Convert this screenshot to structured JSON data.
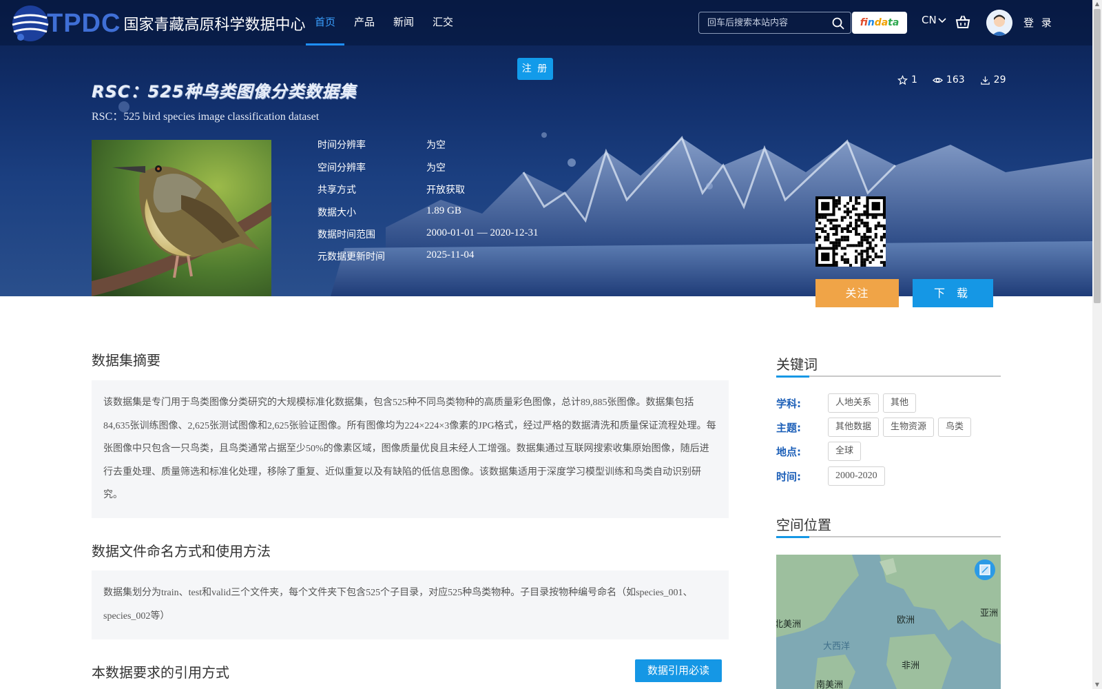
{
  "nav": {
    "logo_text": "TPDC",
    "logo_cn": "国家青藏高原科学数据中心",
    "items": [
      {
        "label": "首页",
        "active": true
      },
      {
        "label": "产品"
      },
      {
        "label": "新闻"
      },
      {
        "label": "汇交"
      }
    ],
    "search_placeholder": "回车后搜索本站内容",
    "findata": [
      "f",
      "in",
      "da",
      "ta"
    ],
    "lang": "CN",
    "login": "登 录"
  },
  "register_label": "注 册",
  "dataset": {
    "title": "RSC：525种鸟类图像分类数据集",
    "subtitle": "RSC：525 bird species image classification dataset",
    "stats": {
      "stars": "1",
      "views": "163",
      "downloads": "29"
    },
    "meta": [
      {
        "label": "时间分辨率",
        "value": "为空"
      },
      {
        "label": "空间分辨率",
        "value": "为空"
      },
      {
        "label": "共享方式",
        "value": "开放获取"
      },
      {
        "label": "数据大小",
        "value": "1.89 GB"
      },
      {
        "label": "数据时间范围",
        "value": "2000-01-01 — 2020-12-31"
      },
      {
        "label": "元数据更新时间",
        "value": "2025-11-04"
      }
    ],
    "follow_label": "关注",
    "download_label": "下 载"
  },
  "summary": {
    "title": "数据集摘要",
    "text": "该数据集是专门用于鸟类图像分类研究的大规模标准化数据集，包含525种不同鸟类物种的高质量彩色图像，总计89,885张图像。数据集包括84,635张训练图像、2,625张测试图像和2,625张验证图像。所有图像均为224×224×3像素的JPG格式，经过严格的数据清洗和质量保证流程处理。每张图像中只包含一只鸟类，且鸟类通常占据至少50%的像素区域，图像质量优良且未经人工增强。数据集通过互联网搜索收集原始图像，随后进行去重处理、质量筛选和标准化处理，移除了重复、近似重复以及有缺陷的低信息图像。该数据集适用于深度学习模型训练和鸟类自动识别研究。"
  },
  "naming": {
    "title": "数据文件命名方式和使用方法",
    "text": "数据集划分为train、test和valid三个文件夹，每个文件夹下包含525个子目录，对应525种鸟类物种。子目录按物种编号命名（如species_001、species_002等）"
  },
  "citation": {
    "title": "本数据要求的引用方式",
    "button": "数据引用必读"
  },
  "keywords": {
    "title": "关键词",
    "rows": [
      {
        "label": "学科:",
        "tags": [
          "人地关系",
          "其他"
        ]
      },
      {
        "label": "主题:",
        "tags": [
          "其他数据",
          "生物资源",
          "鸟类"
        ]
      },
      {
        "label": "地点:",
        "tags": [
          "全球"
        ]
      },
      {
        "label": "时间:",
        "tags": [
          "2000-2020"
        ]
      }
    ]
  },
  "location": {
    "title": "空间位置",
    "labels": [
      "北美洲",
      "欧洲",
      "亚洲",
      "大西洋",
      "非洲",
      "南美洲"
    ]
  },
  "colors": {
    "accent": "#1597e5",
    "follow": "#f0a447",
    "keyword_label": "#1c5fb8"
  }
}
